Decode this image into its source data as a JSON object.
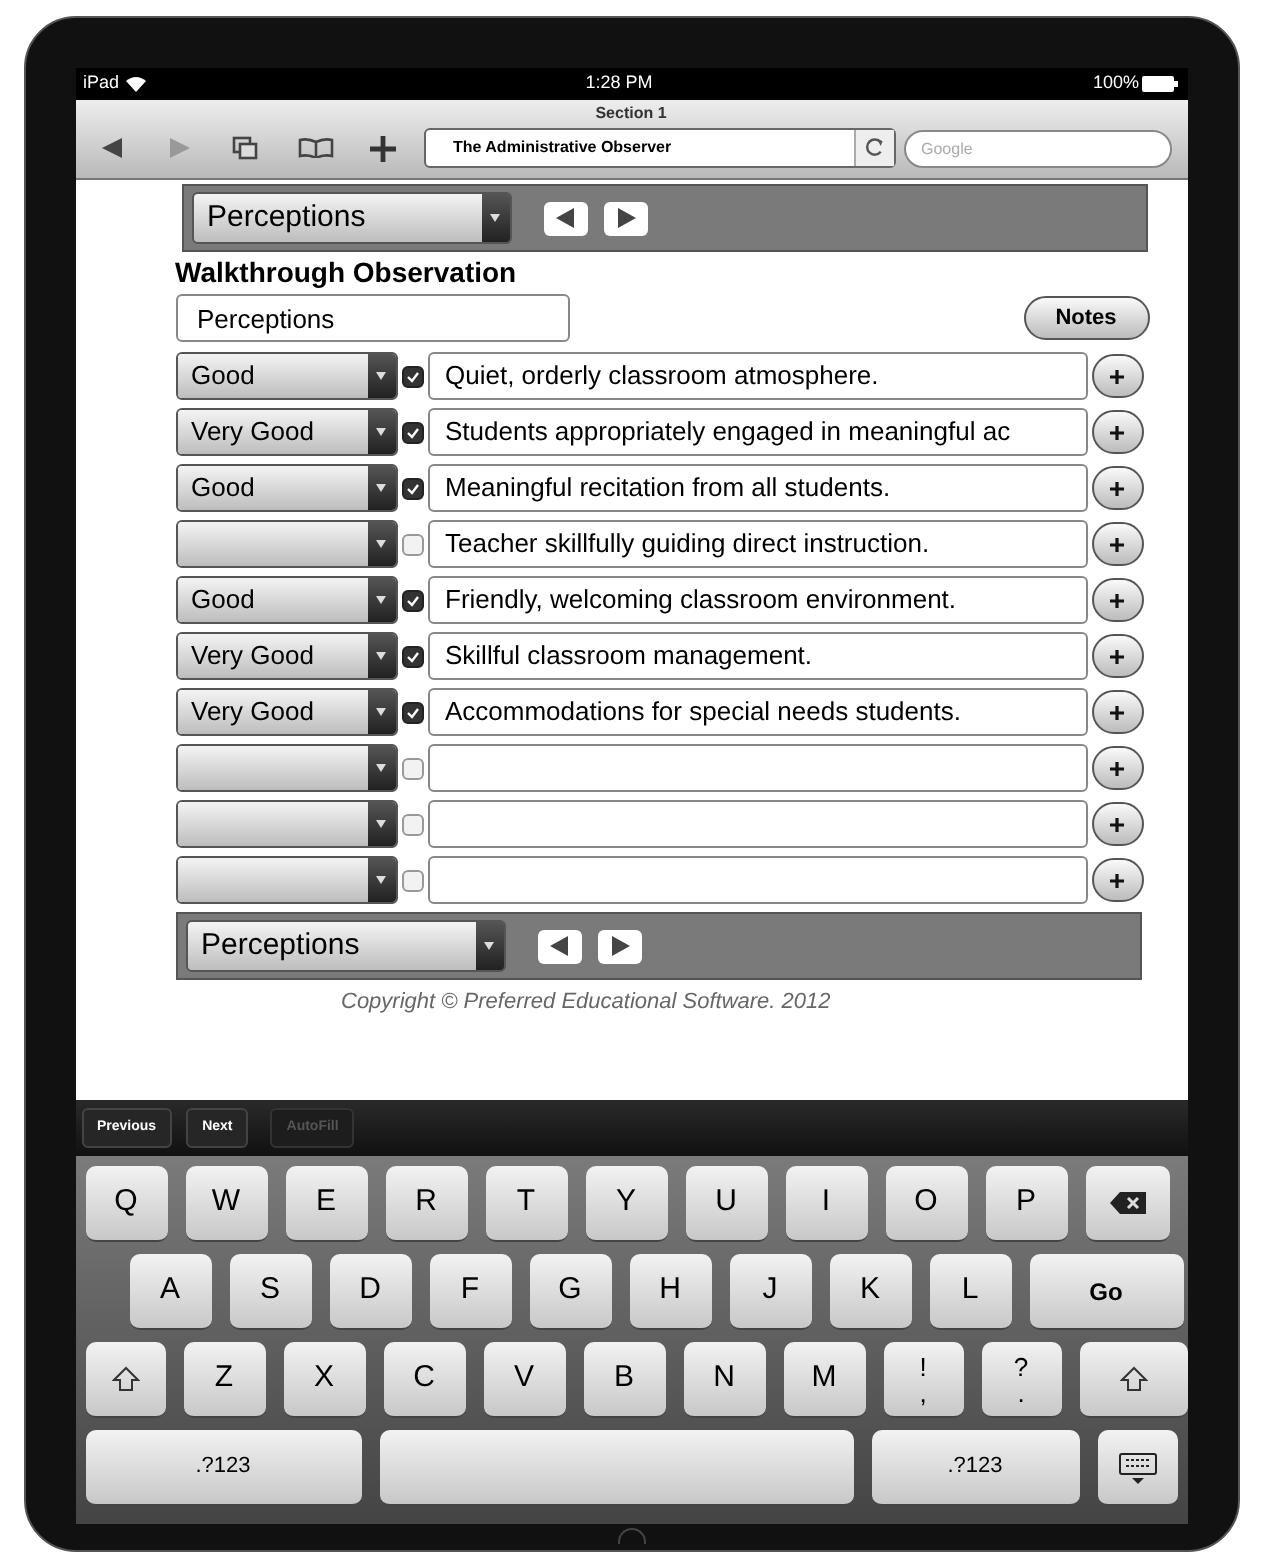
{
  "status_bar": {
    "carrier": "iPad",
    "time": "1:28 PM",
    "battery": "100%"
  },
  "browser": {
    "page_title": "Section 1",
    "url": "The Administrative Observer",
    "search_placeholder": "Google"
  },
  "top_nav": {
    "section": "Perceptions"
  },
  "heading": "Walkthrough Observation",
  "category_field": {
    "value": "Perceptions"
  },
  "notes_button": "Notes",
  "rows": [
    {
      "rating": "Good",
      "checked": true,
      "text": "Quiet, orderly classroom atmosphere."
    },
    {
      "rating": "Very Good",
      "checked": true,
      "text": "Students appropriately engaged in meaningful ac"
    },
    {
      "rating": "Good",
      "checked": true,
      "text": "Meaningful recitation from all students."
    },
    {
      "checked": false,
      "text": "Teacher skillfully guiding direct instruction."
    },
    {
      "rating": "Good",
      "checked": true,
      "text": "Friendly, welcoming classroom environment."
    },
    {
      "rating": "Very Good",
      "checked": true,
      "text": "Skillful classroom management."
    },
    {
      "rating": "Very Good",
      "checked": true,
      "text": "Accommodations for special needs students."
    },
    {
      "checked": false
    },
    {
      "checked": false
    },
    {
      "checked": false
    }
  ],
  "bottom_nav": {
    "section": "Perceptions"
  },
  "copyright": "Copyright © Preferred Educational Software. 2012",
  "form_assistant": [
    {
      "label": "Previous",
      "disabled": false
    },
    {
      "label": "Next",
      "disabled": false
    },
    {
      "label": "AutoFill",
      "disabled": true
    }
  ],
  "keyboard": [
    [
      {
        "kind": "char",
        "label": "Q"
      },
      {
        "kind": "char",
        "label": "W"
      },
      {
        "kind": "char",
        "label": "E"
      },
      {
        "kind": "char",
        "label": "R"
      },
      {
        "kind": "char",
        "label": "T"
      },
      {
        "kind": "char",
        "label": "Y"
      },
      {
        "kind": "char",
        "label": "U"
      },
      {
        "kind": "char",
        "label": "I"
      },
      {
        "kind": "char",
        "label": "O"
      },
      {
        "kind": "char",
        "label": "P"
      },
      {
        "kind": "backspace"
      }
    ],
    [
      {
        "kind": "char",
        "label": "A"
      },
      {
        "kind": "char",
        "label": "S"
      },
      {
        "kind": "char",
        "label": "D"
      },
      {
        "kind": "char",
        "label": "F"
      },
      {
        "kind": "char",
        "label": "G"
      },
      {
        "kind": "char",
        "label": "H"
      },
      {
        "kind": "char",
        "label": "J"
      },
      {
        "kind": "char",
        "label": "K"
      },
      {
        "kind": "char",
        "label": "L"
      },
      {
        "kind": "wide",
        "label": "Go"
      }
    ],
    [
      {
        "kind": "shift"
      },
      {
        "kind": "char",
        "label": "Z"
      },
      {
        "kind": "char",
        "label": "X"
      },
      {
        "kind": "char",
        "label": "C"
      },
      {
        "kind": "char",
        "label": "V"
      },
      {
        "kind": "char",
        "label": "B"
      },
      {
        "kind": "char",
        "label": "N"
      },
      {
        "kind": "char",
        "label": "M"
      },
      {
        "kind": "dual",
        "label": "!",
        "sub": ","
      },
      {
        "kind": "dual",
        "label": "?",
        "sub": "."
      },
      {
        "kind": "shift"
      }
    ],
    [
      {
        "kind": "numbers",
        "label": ".?123"
      },
      {
        "kind": "space"
      },
      {
        "kind": "numbers2",
        "label": ".?123"
      },
      {
        "kind": "dismiss"
      }
    ]
  ]
}
